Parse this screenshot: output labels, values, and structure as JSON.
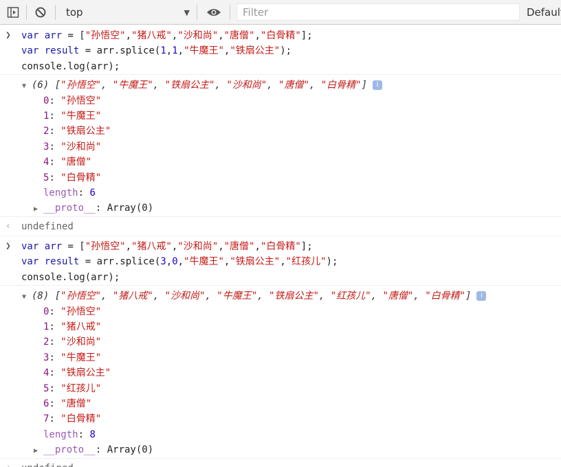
{
  "toolbar": {
    "context": "top",
    "filter_placeholder": "Filter",
    "levels": "Default"
  },
  "blocks": [
    {
      "input": [
        [
          [
            "kw",
            "var "
          ],
          [
            "vr",
            "arr"
          ],
          [
            "plain",
            " = ["
          ],
          [
            "str",
            "\"孙悟空\""
          ],
          [
            "plain",
            ","
          ],
          [
            "str",
            "\"猪八戒\""
          ],
          [
            "plain",
            ","
          ],
          [
            "str",
            "\"沙和尚\""
          ],
          [
            "plain",
            ","
          ],
          [
            "str",
            "\"唐僧\""
          ],
          [
            "plain",
            ","
          ],
          [
            "str",
            "\"白骨精\""
          ],
          [
            "plain",
            "];"
          ]
        ],
        [
          [
            "kw",
            "var "
          ],
          [
            "vr",
            "result"
          ],
          [
            "plain",
            " = arr.splice("
          ],
          [
            "num",
            "1"
          ],
          [
            "plain",
            ","
          ],
          [
            "num",
            "1"
          ],
          [
            "plain",
            ","
          ],
          [
            "str",
            "\"牛魔王\""
          ],
          [
            "plain",
            ","
          ],
          [
            "str",
            "\"铁扇公主\""
          ],
          [
            "plain",
            ");"
          ]
        ],
        [
          [
            "plain",
            "console.log(arr);"
          ]
        ]
      ],
      "count": "(6)",
      "summary": [
        "\"孙悟空\"",
        "\"牛魔王\"",
        "\"铁扇公主\"",
        "\"沙和尚\"",
        "\"唐僧\"",
        "\"白骨精\""
      ],
      "items": [
        {
          "key": "0",
          "value": "\"孙悟空\""
        },
        {
          "key": "1",
          "value": "\"牛魔王\""
        },
        {
          "key": "2",
          "value": "\"铁扇公主\""
        },
        {
          "key": "3",
          "value": "\"沙和尚\""
        },
        {
          "key": "4",
          "value": "\"唐僧\""
        },
        {
          "key": "5",
          "value": "\"白骨精\""
        }
      ],
      "length": "6",
      "proto": "Array(0)",
      "return": "undefined"
    },
    {
      "input": [
        [
          [
            "kw",
            "var "
          ],
          [
            "vr",
            "arr"
          ],
          [
            "plain",
            " = ["
          ],
          [
            "str",
            "\"孙悟空\""
          ],
          [
            "plain",
            ","
          ],
          [
            "str",
            "\"猪八戒\""
          ],
          [
            "plain",
            ","
          ],
          [
            "str",
            "\"沙和尚\""
          ],
          [
            "plain",
            ","
          ],
          [
            "str",
            "\"唐僧\""
          ],
          [
            "plain",
            ","
          ],
          [
            "str",
            "\"白骨精\""
          ],
          [
            "plain",
            "];"
          ]
        ],
        [
          [
            "kw",
            "var "
          ],
          [
            "vr",
            "result"
          ],
          [
            "plain",
            " = arr.splice("
          ],
          [
            "num",
            "3"
          ],
          [
            "plain",
            ","
          ],
          [
            "num",
            "0"
          ],
          [
            "plain",
            ","
          ],
          [
            "str",
            "\"牛魔王\""
          ],
          [
            "plain",
            ","
          ],
          [
            "str",
            "\"铁扇公主\""
          ],
          [
            "plain",
            ","
          ],
          [
            "str",
            "\"红孩儿\""
          ],
          [
            "plain",
            ");"
          ]
        ],
        [
          [
            "plain",
            "console.log(arr);"
          ]
        ]
      ],
      "count": "(8)",
      "summary": [
        "\"孙悟空\"",
        "\"猪八戒\"",
        "\"沙和尚\"",
        "\"牛魔王\"",
        "\"铁扇公主\"",
        "\"红孩儿\"",
        "\"唐僧\"",
        "\"白骨精\""
      ],
      "items": [
        {
          "key": "0",
          "value": "\"孙悟空\""
        },
        {
          "key": "1",
          "value": "\"猪八戒\""
        },
        {
          "key": "2",
          "value": "\"沙和尚\""
        },
        {
          "key": "3",
          "value": "\"牛魔王\""
        },
        {
          "key": "4",
          "value": "\"铁扇公主\""
        },
        {
          "key": "5",
          "value": "\"红孩儿\""
        },
        {
          "key": "6",
          "value": "\"唐僧\""
        },
        {
          "key": "7",
          "value": "\"白骨精\""
        }
      ],
      "length": "8",
      "proto": "Array(0)",
      "return": "undefined"
    }
  ],
  "labels": {
    "length_key": "length",
    "proto_key": "__proto__"
  },
  "icons": {
    "sidebar": "sidebar-toggle-icon",
    "clear": "clear-console-icon",
    "eye": "live-expression-eye-icon",
    "info": "info-icon"
  }
}
